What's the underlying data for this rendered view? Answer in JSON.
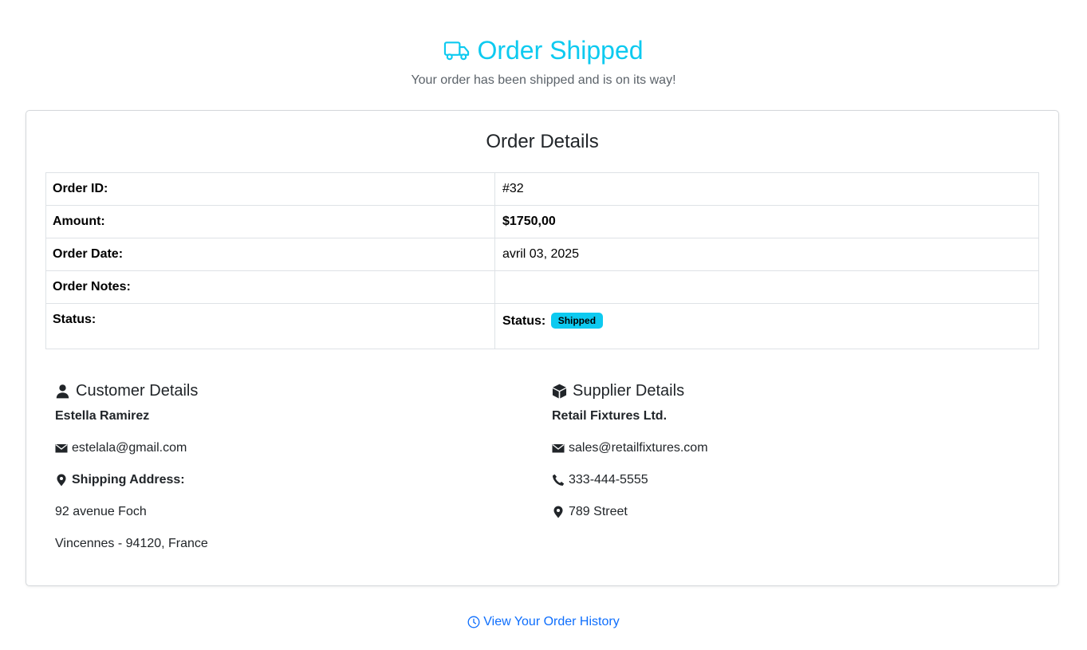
{
  "header": {
    "icon": "truck-icon",
    "title": "Order Shipped",
    "subtitle": "Your order has been shipped and is on its way!",
    "accent_color": "#0dcaf0"
  },
  "order": {
    "heading": "Order Details",
    "rows": [
      {
        "label": "Order ID:",
        "value": "#32"
      },
      {
        "label": "Amount:",
        "value": "$1750,00"
      },
      {
        "label": "Order Date:",
        "value": "avril 03, 2025"
      },
      {
        "label": "Order Notes:",
        "value": ""
      },
      {
        "label": "Status:",
        "value_label": "Status:",
        "badge": "Shipped",
        "badge_color": "#0dcaf0"
      }
    ]
  },
  "customer": {
    "heading": "Customer Details",
    "icon": "user-icon",
    "name": "Estella Ramirez",
    "email": "estelala@gmail.com",
    "shipping_label": "Shipping Address:",
    "address_line1": "92 avenue Foch",
    "address_line2": "Vincennes - 94120, France"
  },
  "supplier": {
    "heading": "Supplier Details",
    "icon": "box-icon",
    "name": "Retail Fixtures Ltd.",
    "email": "sales@retailfixtures.com",
    "phone": "333-444-5555",
    "address": "789 Street"
  },
  "footer": {
    "history_link": "View Your Order History",
    "icon": "clock-icon",
    "link_color": "#0d6efd"
  }
}
